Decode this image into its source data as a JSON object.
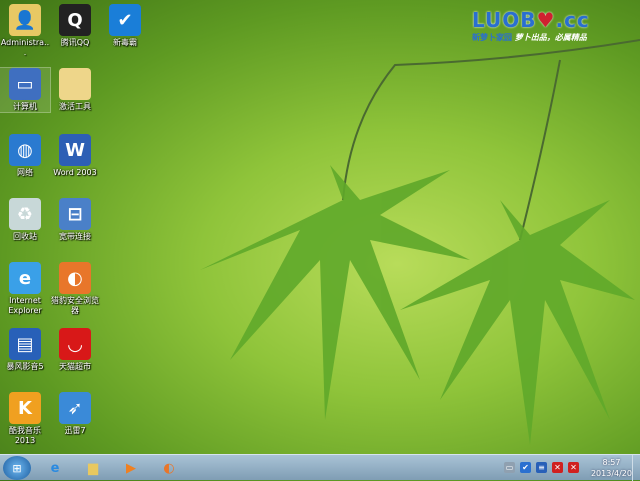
{
  "desktop": {
    "icons": [
      {
        "label": "Administra...",
        "icon": "user-folder-icon",
        "color": "#e8c864",
        "glyph": "👤"
      },
      {
        "label": "腾讯QQ",
        "icon": "qq-penguin-icon",
        "color": "#222222",
        "glyph": "Q"
      },
      {
        "label": "新毒霸",
        "icon": "duba-antivirus-icon",
        "color": "#1a7ed8",
        "glyph": "✔"
      },
      {
        "label": "计算机",
        "icon": "computer-icon",
        "color": "#3f6fc0",
        "glyph": "▭"
      },
      {
        "label": "激活工具",
        "icon": "folder-icon",
        "color": "#eed68a",
        "glyph": ""
      },
      {
        "label": "网络",
        "icon": "network-icon",
        "color": "#2a7ad0",
        "glyph": "◍"
      },
      {
        "label": "Word 2003",
        "icon": "word-icon",
        "color": "#2d5fb5",
        "glyph": "W"
      },
      {
        "label": "回收站",
        "icon": "recycle-bin-icon",
        "color": "#c8d8d8",
        "glyph": "♻"
      },
      {
        "label": "宽带连接",
        "icon": "broadband-connection-icon",
        "color": "#4a80c8",
        "glyph": "⊟"
      },
      {
        "label": "Internet Explorer",
        "icon": "internet-explorer-icon",
        "color": "#3aa0e8",
        "glyph": "e"
      },
      {
        "label": "猎豹安全浏览器",
        "icon": "liebao-browser-icon",
        "color": "#e8762a",
        "glyph": "◐"
      },
      {
        "label": "暴风影音5",
        "icon": "baofeng-player-icon",
        "color": "#2860b8",
        "glyph": "▤"
      },
      {
        "label": "天猫超市",
        "icon": "tmall-market-icon",
        "color": "#d81818",
        "glyph": "◡"
      },
      {
        "label": "酷我音乐2013",
        "icon": "kuwo-music-icon",
        "color": "#f0a020",
        "glyph": "K"
      },
      {
        "label": "迅雷7",
        "icon": "xunlei-bird-icon",
        "color": "#3a8ad8",
        "glyph": "➶"
      }
    ]
  },
  "logo": {
    "brand": "LUOB",
    "suffix": ".cc",
    "sub1": "新萝卜家园",
    "sub2": "萝卜出品，必属精品"
  },
  "taskbar": {
    "pinned": [
      {
        "name": "internet-explorer",
        "glyph": "e",
        "color": "#2a8ae0"
      },
      {
        "name": "file-explorer",
        "glyph": "▆",
        "color": "#e8c860"
      },
      {
        "name": "media-player",
        "glyph": "▶",
        "color": "#f08020"
      },
      {
        "name": "liebao-browser",
        "glyph": "◐",
        "color": "#e8762a"
      }
    ],
    "tray": [
      {
        "name": "keyboard",
        "glyph": "▭",
        "color": "#8fa0b0"
      },
      {
        "name": "duba",
        "glyph": "✔",
        "color": "#2a70d0"
      },
      {
        "name": "baofeng",
        "glyph": "≡",
        "color": "#2860b8"
      },
      {
        "name": "network-error",
        "glyph": "✕",
        "color": "#d02020"
      },
      {
        "name": "volume-muted",
        "glyph": "✕",
        "color": "#d02020"
      }
    ],
    "time": "8:57",
    "date": "2013/4/20"
  }
}
